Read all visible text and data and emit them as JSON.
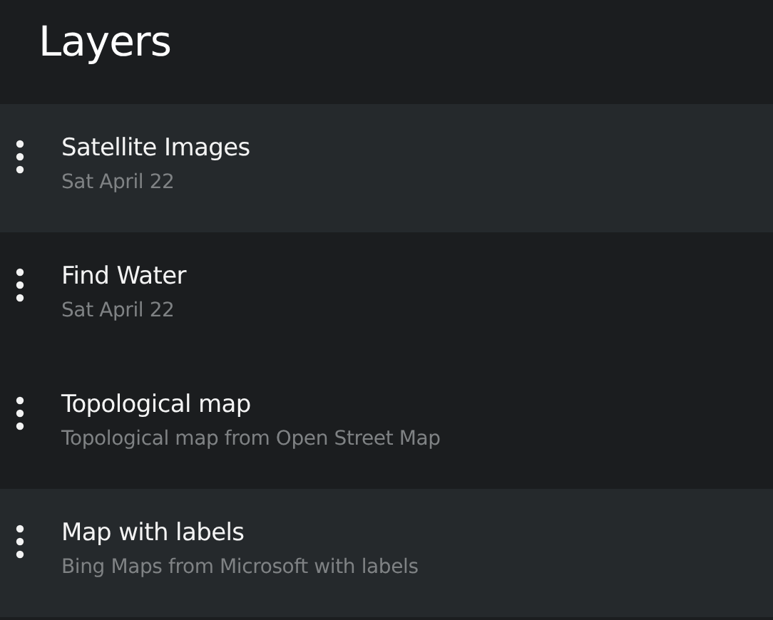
{
  "panel": {
    "title": "Layers"
  },
  "layers": [
    {
      "name": "Satellite Images",
      "detail": "Sat April 22",
      "selected": true
    },
    {
      "name": "Find Water",
      "detail": "Sat April 22",
      "selected": false
    },
    {
      "name": "Topological map",
      "detail": "Topological map from Open Street Map",
      "selected": false
    },
    {
      "name": "Map with labels",
      "detail": "Bing Maps from Microsoft with labels",
      "selected": true
    }
  ]
}
